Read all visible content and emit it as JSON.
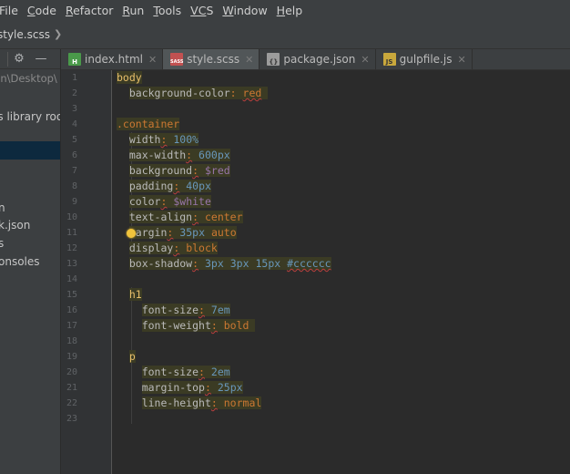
{
  "menu": [
    {
      "mn": "",
      "rest": "File"
    },
    {
      "mn": "C",
      "rest": "ode"
    },
    {
      "mn": "R",
      "rest": "efactor"
    },
    {
      "mn": "R",
      "rest": "un"
    },
    {
      "mn": "T",
      "rest": "ools"
    },
    {
      "mn": "VC",
      "rest": "S"
    },
    {
      "mn": "W",
      "rest": "indow"
    },
    {
      "mn": "H",
      "rest": "elp"
    }
  ],
  "breadcrumb": {
    "file": "style.scss"
  },
  "sidebar": {
    "path": "gon\\Desktop\\",
    "external_libs": "es library roo",
    "items": [
      "n",
      "k.json",
      "s",
      "onsoles"
    ]
  },
  "tabs": [
    {
      "label": "index.html",
      "icon": "html-file-icon",
      "icon_color": "#4a9a4a",
      "icon_text": "H",
      "active": false
    },
    {
      "label": "style.scss",
      "icon": "scss-file-icon",
      "icon_color": "#c25151",
      "icon_text": "SASS",
      "active": true
    },
    {
      "label": "package.json",
      "icon": "json-file-icon",
      "icon_color": "#9c9c9c",
      "icon_text": "{}",
      "active": false
    },
    {
      "label": "gulpfile.js",
      "icon": "js-file-icon",
      "icon_color": "#c9a83c",
      "icon_text": "JS",
      "active": false
    }
  ],
  "code": {
    "line_numbers": [
      "1",
      "2",
      "3",
      "4",
      "5",
      "6",
      "7",
      "8",
      "9",
      "10",
      "11",
      "12",
      "13",
      "14",
      "15",
      "16",
      "17",
      "18",
      "19",
      "20",
      "21",
      "22",
      "23"
    ],
    "l1": "body",
    "l2_prop": "background-color",
    "l2_val": "red",
    "l4": ".container",
    "l5_prop": "width",
    "l5_val": "100",
    "l5_unit": "%",
    "l6_prop": "max-width",
    "l6_val": "600",
    "l6_unit": "px",
    "l7_prop": "background",
    "l7_val": "$red",
    "l8_prop": "padding",
    "l8_val": "40",
    "l8_unit": "px",
    "l9_prop": "color",
    "l9_val": "$white",
    "l10_prop": "text-align",
    "l10_val": "center",
    "l11_prop": "margin",
    "l11_val": "35",
    "l11_unit": "px",
    "l11_val2": "auto",
    "l12_prop": "display",
    "l12_val": "block",
    "l13_prop": "box-shadow",
    "l13_v1": "3",
    "l13_v2": "3",
    "l13_v3": "15",
    "l13_unit": "px",
    "l13_hex": "#cccccc",
    "l15": "h1",
    "l16_prop": "font-size",
    "l16_val": "7",
    "l16_unit": "em",
    "l17_prop": "font-weight",
    "l17_val": "bold",
    "l19": "p",
    "l20_prop": "font-size",
    "l20_val": "2",
    "l20_unit": "em",
    "l21_prop": "margin-top",
    "l21_val": "25",
    "l21_unit": "px",
    "l22_prop": "line-height",
    "l22_val": "normal"
  }
}
